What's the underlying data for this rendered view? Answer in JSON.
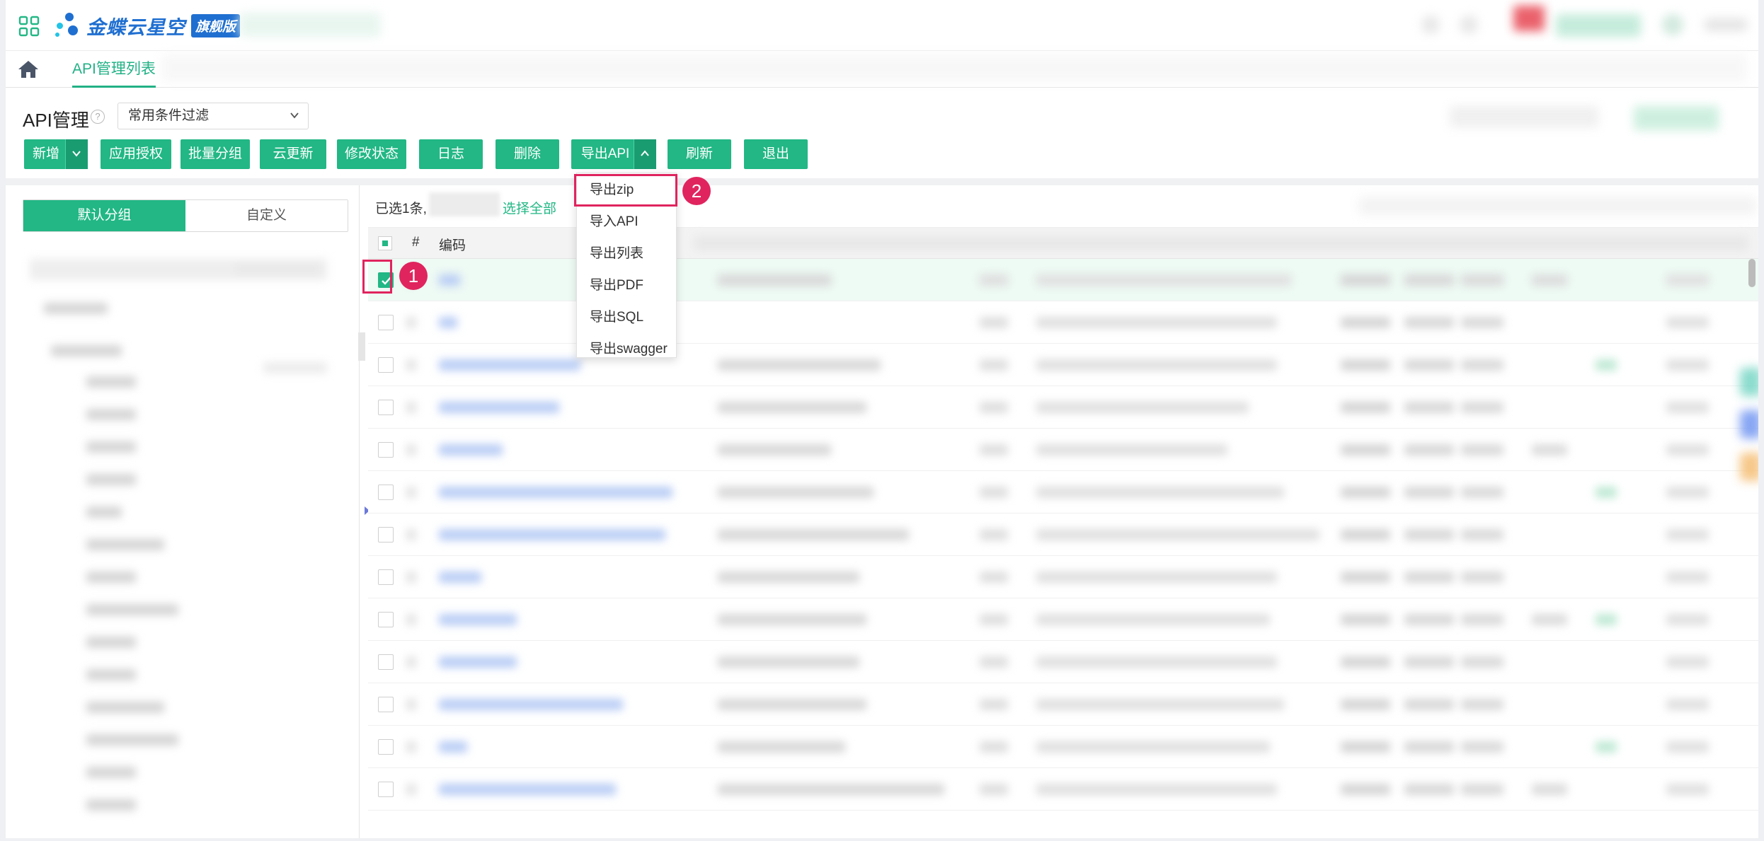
{
  "header": {
    "apps_icon": "grid-apps-icon",
    "brand_name": "金蝶云星空",
    "brand_badge": "旗舰版"
  },
  "tabs": {
    "home_icon": "home-icon",
    "active_tab": "API管理列表"
  },
  "page": {
    "title": "API管理",
    "filter_select": "常用条件过滤"
  },
  "toolbar": {
    "buttons": [
      "新增",
      "应用授权",
      "批量分组",
      "云更新",
      "修改状态",
      "日志",
      "删除",
      "导出API",
      "刷新",
      "退出"
    ]
  },
  "left_panel": {
    "segment_default": "默认分组",
    "segment_custom": "自定义"
  },
  "selection": {
    "selected_text": "已选1条,",
    "select_all": "选择全部"
  },
  "table": {
    "header_num": "#",
    "header_code": "编码"
  },
  "export_menu": {
    "items": [
      "导出zip",
      "导入API",
      "导出列表",
      "导出PDF",
      "导出SQL",
      "导出swagger"
    ]
  },
  "annotations": {
    "step1": "1",
    "step2": "2"
  },
  "colors": {
    "primary": "#22b785",
    "highlight": "#e0245e",
    "brand": "#1f6fd1"
  }
}
